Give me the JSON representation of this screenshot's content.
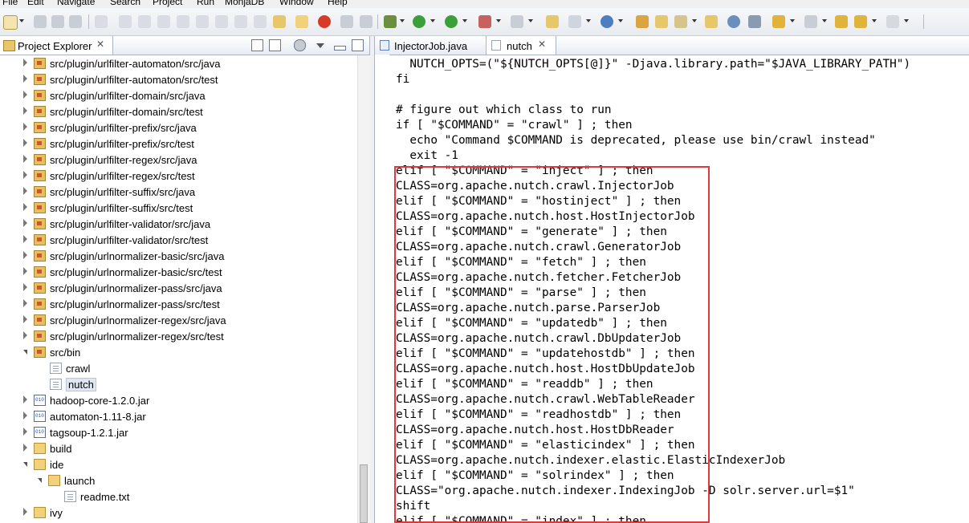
{
  "menu": [
    "File",
    "Edit",
    "Navigate",
    "Search",
    "Project",
    "Run",
    "MonjaDB",
    "Window",
    "Help"
  ],
  "project_explorer": {
    "title": "Project Explorer",
    "tree": [
      {
        "label": "src/plugin/urlfilter-automaton/src/java",
        "type": "package"
      },
      {
        "label": "src/plugin/urlfilter-automaton/src/test",
        "type": "package"
      },
      {
        "label": "src/plugin/urlfilter-domain/src/java",
        "type": "package"
      },
      {
        "label": "src/plugin/urlfilter-domain/src/test",
        "type": "package"
      },
      {
        "label": "src/plugin/urlfilter-prefix/src/java",
        "type": "package"
      },
      {
        "label": "src/plugin/urlfilter-prefix/src/test",
        "type": "package"
      },
      {
        "label": "src/plugin/urlfilter-regex/src/java",
        "type": "package"
      },
      {
        "label": "src/plugin/urlfilter-regex/src/test",
        "type": "package"
      },
      {
        "label": "src/plugin/urlfilter-suffix/src/java",
        "type": "package"
      },
      {
        "label": "src/plugin/urlfilter-suffix/src/test",
        "type": "package"
      },
      {
        "label": "src/plugin/urlfilter-validator/src/java",
        "type": "package"
      },
      {
        "label": "src/plugin/urlfilter-validator/src/test",
        "type": "package"
      },
      {
        "label": "src/plugin/urlnormalizer-basic/src/java",
        "type": "package"
      },
      {
        "label": "src/plugin/urlnormalizer-basic/src/test",
        "type": "package"
      },
      {
        "label": "src/plugin/urlnormalizer-pass/src/java",
        "type": "package"
      },
      {
        "label": "src/plugin/urlnormalizer-pass/src/test",
        "type": "package"
      },
      {
        "label": "src/plugin/urlnormalizer-regex/src/java",
        "type": "package"
      },
      {
        "label": "src/plugin/urlnormalizer-regex/src/test",
        "type": "package"
      },
      {
        "label": "src/bin",
        "type": "package",
        "expanded": true
      },
      {
        "label": "crawl",
        "type": "file"
      },
      {
        "label": "nutch",
        "type": "file",
        "selected": true
      },
      {
        "label": "hadoop-core-1.2.0.jar",
        "type": "jar"
      },
      {
        "label": "automaton-1.11-8.jar",
        "type": "jar"
      },
      {
        "label": "tagsoup-1.2.1.jar",
        "type": "jar"
      },
      {
        "label": "build",
        "type": "folder"
      },
      {
        "label": "ide",
        "type": "folder",
        "expanded": true
      },
      {
        "label": "launch",
        "type": "folder",
        "expanded": true
      },
      {
        "label": "readme.txt",
        "type": "file"
      },
      {
        "label": "ivy",
        "type": "folder"
      }
    ]
  },
  "editor": {
    "tabs": [
      {
        "label": "InjectorJob.java",
        "active": false
      },
      {
        "label": "nutch",
        "active": true
      }
    ],
    "lines": [
      "  NUTCH_OPTS=(\"${NUTCH_OPTS[@]}\" -Djava.library.path=\"$JAVA_LIBRARY_PATH\")",
      "fi",
      "",
      "# figure out which class to run",
      "if [ \"$COMMAND\" = \"crawl\" ] ; then",
      "  echo \"Command $COMMAND is deprecated, please use bin/crawl instead\"",
      "  exit -1",
      "elif [ \"$COMMAND\" = \"inject\" ] ; then",
      "CLASS=org.apache.nutch.crawl.InjectorJob",
      "elif [ \"$COMMAND\" = \"hostinject\" ] ; then",
      "CLASS=org.apache.nutch.host.HostInjectorJob",
      "elif [ \"$COMMAND\" = \"generate\" ] ; then",
      "CLASS=org.apache.nutch.crawl.GeneratorJob",
      "elif [ \"$COMMAND\" = \"fetch\" ] ; then",
      "CLASS=org.apache.nutch.fetcher.FetcherJob",
      "elif [ \"$COMMAND\" = \"parse\" ] ; then",
      "CLASS=org.apache.nutch.parse.ParserJob",
      "elif [ \"$COMMAND\" = \"updatedb\" ] ; then",
      "CLASS=org.apache.nutch.crawl.DbUpdaterJob",
      "elif [ \"$COMMAND\" = \"updatehostdb\" ] ; then",
      "CLASS=org.apache.nutch.host.HostDbUpdateJob",
      "elif [ \"$COMMAND\" = \"readdb\" ] ; then",
      "CLASS=org.apache.nutch.crawl.WebTableReader",
      "elif [ \"$COMMAND\" = \"readhostdb\" ] ; then",
      "CLASS=org.apache.nutch.host.HostDbReader",
      "elif [ \"$COMMAND\" = \"elasticindex\" ] ; then",
      "CLASS=org.apache.nutch.indexer.elastic.ElasticIndexerJob",
      "elif [ \"$COMMAND\" = \"solrindex\" ] ; then",
      "CLASS=\"org.apache.nutch.indexer.IndexingJob -D solr.server.url=$1\"",
      "shift",
      "elif [ \"$COMMAND\" = \"index\" ] ; then"
    ],
    "highlight_color": "#e0393b"
  }
}
